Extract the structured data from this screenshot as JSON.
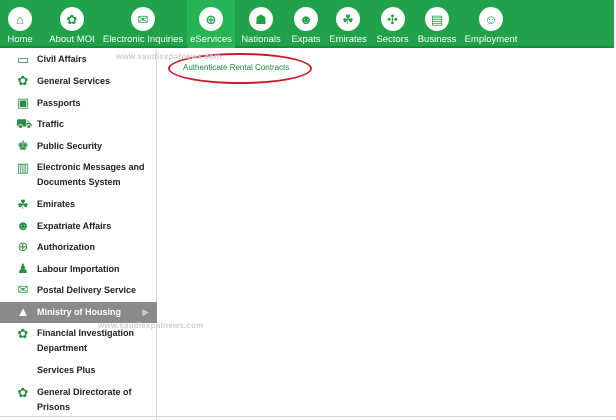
{
  "nav": {
    "items": [
      {
        "label": "Home",
        "icon": "home-icon",
        "glyph": "⌂"
      },
      {
        "label": "About MOI",
        "icon": "emblem-icon",
        "glyph": "✿"
      },
      {
        "label": "Electronic Inquiries",
        "icon": "inquiries-icon",
        "glyph": "✉"
      },
      {
        "label": "eServices",
        "icon": "globe-icon",
        "glyph": "⊕"
      },
      {
        "label": "Nationals",
        "icon": "person-icon",
        "glyph": "☗"
      },
      {
        "label": "Expats",
        "icon": "group-icon",
        "glyph": "☻"
      },
      {
        "label": "Emirates",
        "icon": "emirates-icon",
        "glyph": "☘"
      },
      {
        "label": "Sectors",
        "icon": "sectors-icon",
        "glyph": "✣"
      },
      {
        "label": "Business",
        "icon": "briefcase-icon",
        "glyph": "▤"
      },
      {
        "label": "Employment",
        "icon": "employment-icon",
        "glyph": "☺"
      }
    ]
  },
  "sidebar": {
    "items": [
      {
        "label": "Civil Affairs",
        "icon": "id-card-icon",
        "glyph": "▭"
      },
      {
        "label": "General Services",
        "icon": "emblem-icon",
        "glyph": "✿"
      },
      {
        "label": "Passports",
        "icon": "passport-icon",
        "glyph": "▣"
      },
      {
        "label": "Traffic",
        "icon": "car-icon",
        "glyph": "⛟"
      },
      {
        "label": "Public Security",
        "icon": "officer-icon",
        "glyph": "♚"
      },
      {
        "label": "Electronic Messages and Documents System",
        "icon": "document-icon",
        "glyph": "▥"
      },
      {
        "label": "Emirates",
        "icon": "emirates-icon",
        "glyph": "☘"
      },
      {
        "label": "Expatriate Affairs",
        "icon": "people-icon",
        "glyph": "☻"
      },
      {
        "label": "Authorization",
        "icon": "globe-icon",
        "glyph": "⊕"
      },
      {
        "label": "Labour Importation",
        "icon": "worker-icon",
        "glyph": "♟"
      },
      {
        "label": "Postal Delivery Service",
        "icon": "mailbox-icon",
        "glyph": "✉"
      },
      {
        "label": "Ministry of Housing",
        "icon": "housing-icon",
        "glyph": "▲"
      },
      {
        "label": "Financial Investigation Department",
        "icon": "emblem-icon",
        "glyph": "✿"
      },
      {
        "label": "Services Plus",
        "icon": "",
        "glyph": ""
      },
      {
        "label": "General Directorate of Prisons",
        "icon": "emblem-icon",
        "glyph": "✿"
      }
    ]
  },
  "submenu": {
    "link": "Authenticate Rental Contracts"
  },
  "watermark": "www.saudiexpatnews.com",
  "colors": {
    "nav_bg": "#1fa24a",
    "nav_active": "#26b455",
    "sidebar_active": "#8a8a8a",
    "link": "#1a8a3a",
    "highlight_ellipse": "#c9202b"
  }
}
